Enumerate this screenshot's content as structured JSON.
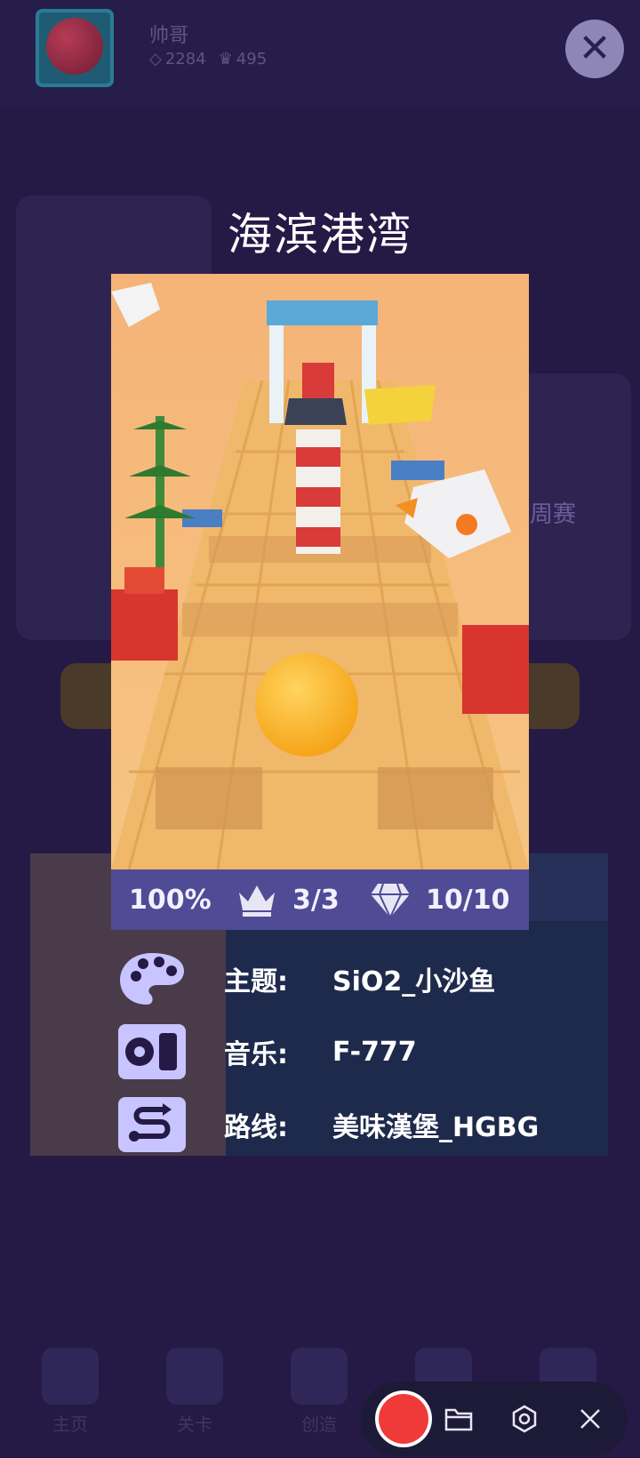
{
  "background": {
    "user_name": "帅哥",
    "gems": "2284",
    "crowns": "495",
    "weekly_label": "周赛",
    "nav": [
      "主页",
      "关卡",
      "创造"
    ]
  },
  "modal": {
    "title": "海滨港湾",
    "stats": {
      "progress": "100%",
      "crowns": "3/3",
      "gems": "10/10"
    },
    "info": [
      {
        "label": "主题:",
        "value": "SiO2_小沙鱼",
        "icon": "palette-icon"
      },
      {
        "label": "音乐:",
        "value": "F-777",
        "icon": "music-player-icon"
      },
      {
        "label": "路线:",
        "value": "美味漢堡_HGBG",
        "icon": "route-icon"
      }
    ]
  },
  "colors": {
    "background": "#241a45",
    "stats_bar": "#4f4b95",
    "icon_tile": "#c8c4ff",
    "record": "#f03a3a"
  }
}
